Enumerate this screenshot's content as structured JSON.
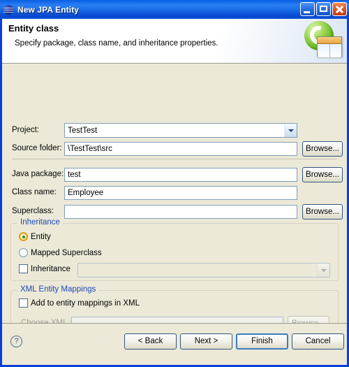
{
  "window": {
    "title": "New JPA Entity",
    "icon": "jpa-sphere-icon",
    "controls": {
      "minimize": "minimize-button",
      "maximize": "maximize-button",
      "close": "close-button"
    }
  },
  "banner": {
    "title": "Entity class",
    "subtitle": "Specify package, class name, and inheritance properties.",
    "icon": "jpa-entity-wizard-icon"
  },
  "form": {
    "project": {
      "label": "Project:",
      "value": "TestTest"
    },
    "source_folder": {
      "label": "Source folder:",
      "value": "\\TestTest\\src",
      "browse": "Browse..."
    },
    "java_package": {
      "label": "Java package:",
      "value": "test",
      "browse": "Browse..."
    },
    "class_name": {
      "label": "Class name:",
      "value": "Employee"
    },
    "superclass": {
      "label": "Superclass:",
      "value": "",
      "browse": "Browse..."
    }
  },
  "inheritance_group": {
    "legend": "Inheritance",
    "entity": {
      "label": "Entity",
      "selected": true
    },
    "mapped_superclass": {
      "label": "Mapped Superclass",
      "selected": false
    },
    "inheritance_check": {
      "label": "Inheritance",
      "checked": false
    },
    "strategy_combo": {
      "value": "",
      "enabled": false
    }
  },
  "xml_group": {
    "legend": "XML Entity Mappings",
    "add_to_mappings": {
      "label": "Add to entity mappings in XML",
      "checked": false
    },
    "choose_xml": {
      "label": "Choose XML :",
      "value": "",
      "browse": "Browse...",
      "enabled": false
    }
  },
  "footer": {
    "help": "?",
    "back": "< Back",
    "next": "Next >",
    "finish": "Finish",
    "cancel": "Cancel"
  },
  "colors": {
    "titlebar": "#1b6fe8",
    "dialog_bg": "#ece9d8",
    "group_legend": "#1d49b5",
    "field_border": "#7f9db9",
    "disabled_text": "#9d9d94"
  }
}
